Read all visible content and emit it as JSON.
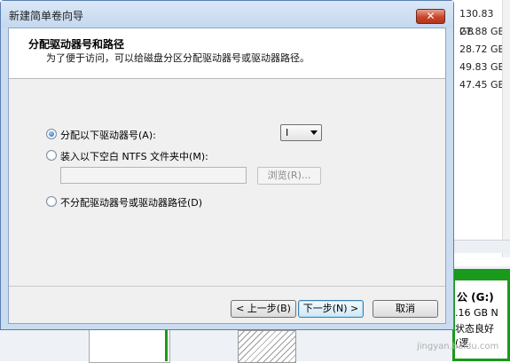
{
  "dialog": {
    "title": "新建简单卷向导",
    "close_label": "✕",
    "header": {
      "title": "分配驱动器号和路径",
      "subtitle": "为了便于访问，可以给磁盘分区分配驱动器号或驱动器路径。"
    },
    "options": {
      "assign_letter": {
        "label": "分配以下驱动器号(A):",
        "selected": true
      },
      "mount_folder": {
        "label": "装入以下空白 NTFS 文件夹中(M):",
        "selected": false
      },
      "no_assign": {
        "label": "不分配驱动器号或驱动器路径(D)",
        "selected": false
      }
    },
    "drive_letter": {
      "value": "I"
    },
    "folder_path": {
      "value": "",
      "placeholder": ""
    },
    "browse_label": "浏览(R)...",
    "buttons": {
      "back": "< 上一步(B)",
      "next": "下一步(N) >",
      "cancel": "取消"
    }
  },
  "background": {
    "sizes": [
      "130.83 GB",
      "27.88 GB",
      "28.72 GB",
      "49.83 GB",
      "47.45 GB"
    ],
    "volume": {
      "title": "公 (G:)",
      "size": ".16 GB N",
      "status": "状态良好 (逻"
    }
  },
  "watermark": "jingyan.baidu.com",
  "colors": {
    "accent": "#1a9a1a",
    "titlebar": "#c4d8ef",
    "close": "#c8452c"
  }
}
